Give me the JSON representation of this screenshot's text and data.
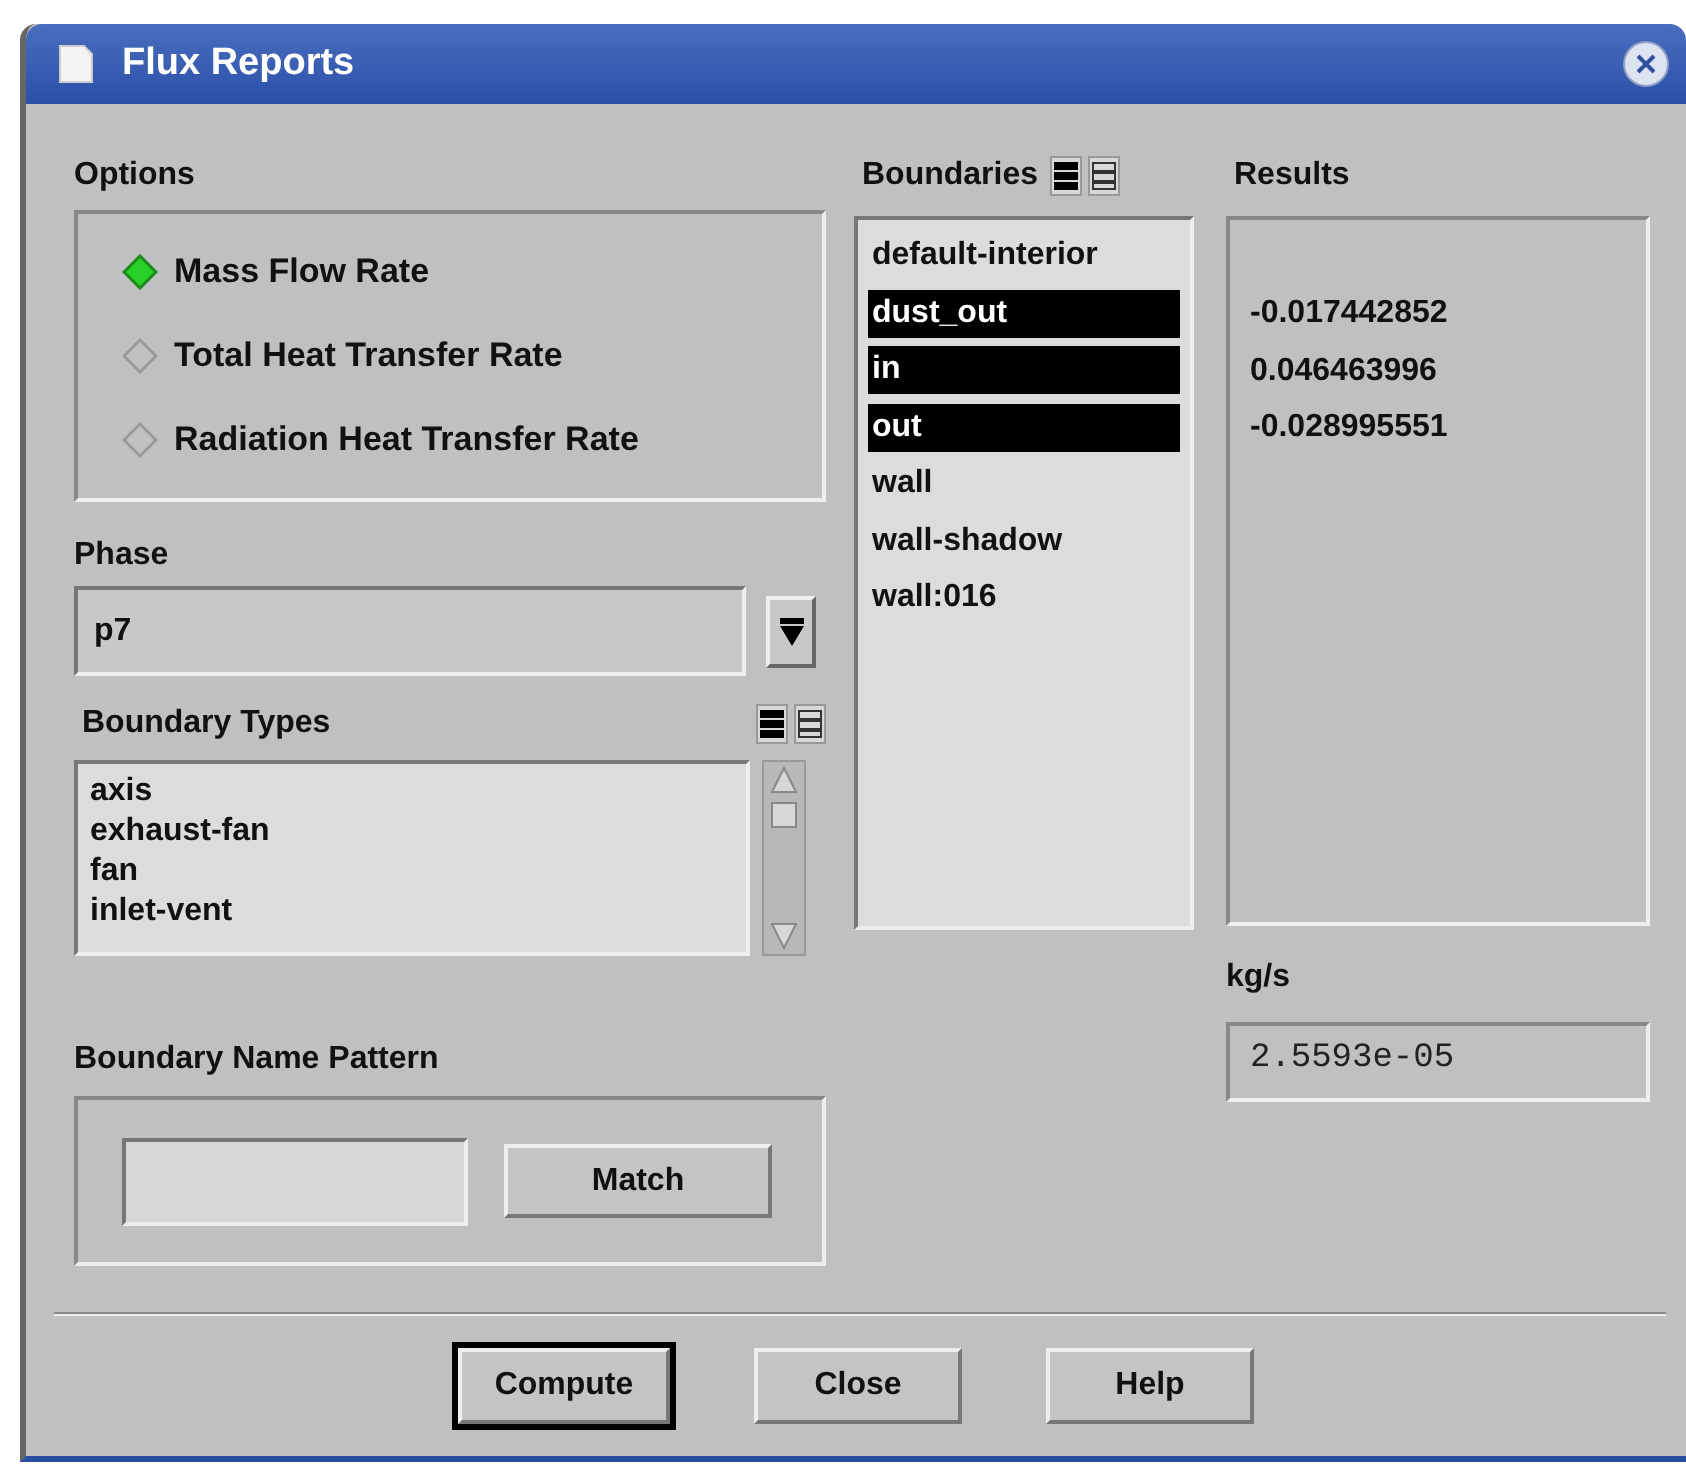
{
  "window": {
    "title": "Flux Reports"
  },
  "options": {
    "label": "Options",
    "items": [
      {
        "label": "Mass Flow Rate",
        "selected": true
      },
      {
        "label": "Total Heat Transfer Rate",
        "selected": false
      },
      {
        "label": "Radiation Heat Transfer Rate",
        "selected": false
      }
    ]
  },
  "phase": {
    "label": "Phase",
    "value": "p7"
  },
  "boundary_types": {
    "label": "Boundary Types",
    "items": [
      {
        "label": "axis",
        "selected": false
      },
      {
        "label": "exhaust-fan",
        "selected": false
      },
      {
        "label": "fan",
        "selected": false
      },
      {
        "label": "inlet-vent",
        "selected": false
      }
    ]
  },
  "boundary_name_pattern": {
    "label": "Boundary Name Pattern",
    "button": "Match"
  },
  "boundaries": {
    "label": "Boundaries",
    "items": [
      {
        "label": "default-interior",
        "selected": false
      },
      {
        "label": "dust_out",
        "selected": true
      },
      {
        "label": "in",
        "selected": true
      },
      {
        "label": "out",
        "selected": true
      },
      {
        "label": "wall",
        "selected": false
      },
      {
        "label": "wall-shadow",
        "selected": false
      },
      {
        "label": "wall:016",
        "selected": false
      }
    ]
  },
  "results": {
    "label": "Results",
    "values": [
      "-0.017442852",
      "0.046463996",
      "-0.028995551"
    ]
  },
  "total": {
    "label": "kg/s",
    "value": "2.5593e-05"
  },
  "buttons": [
    {
      "label": "Compute",
      "default": true
    },
    {
      "label": "Close",
      "default": false
    },
    {
      "label": "Help",
      "default": false
    }
  ]
}
